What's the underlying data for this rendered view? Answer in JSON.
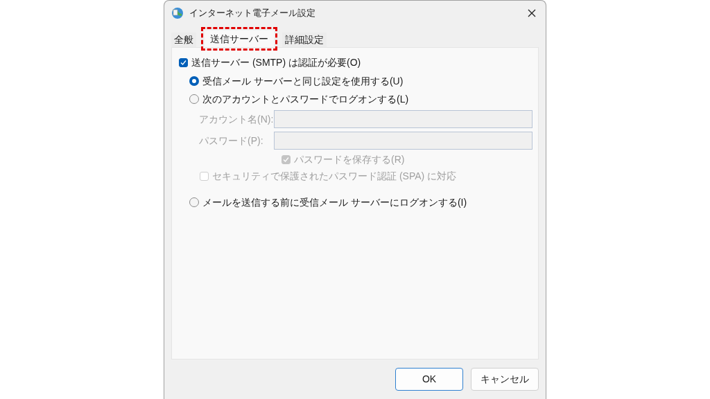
{
  "window": {
    "title": "インターネット電子メール設定"
  },
  "tabs": [
    {
      "label": "全般",
      "selected": false,
      "highlighted": false
    },
    {
      "label": "送信サーバー",
      "selected": true,
      "highlighted": true
    },
    {
      "label": "詳細設定",
      "selected": false,
      "highlighted": false
    }
  ],
  "auth_required": {
    "label": "送信サーバー (SMTP) は認証が必要(O)",
    "checked": true
  },
  "logon_options": [
    {
      "label": "受信メール サーバーと同じ設定を使用する(U)",
      "selected": true
    },
    {
      "label": "次のアカウントとパスワードでログオンする(L)",
      "selected": false
    },
    {
      "label": "メールを送信する前に受信メール サーバーにログオンする(I)",
      "selected": false
    }
  ],
  "credentials": {
    "disabled": true,
    "fields": [
      {
        "label": "アカウント名(N):"
      },
      {
        "label": "パスワード(P):"
      }
    ],
    "save_password": {
      "label": "パスワードを保存する(R)",
      "checked": true
    },
    "spa": {
      "label": "セキュリティで保護されたパスワード認証 (SPA) に対応",
      "checked": false
    }
  },
  "buttons": [
    {
      "label": "OK",
      "default": true
    },
    {
      "label": "キャンセル",
      "default": false
    }
  ]
}
